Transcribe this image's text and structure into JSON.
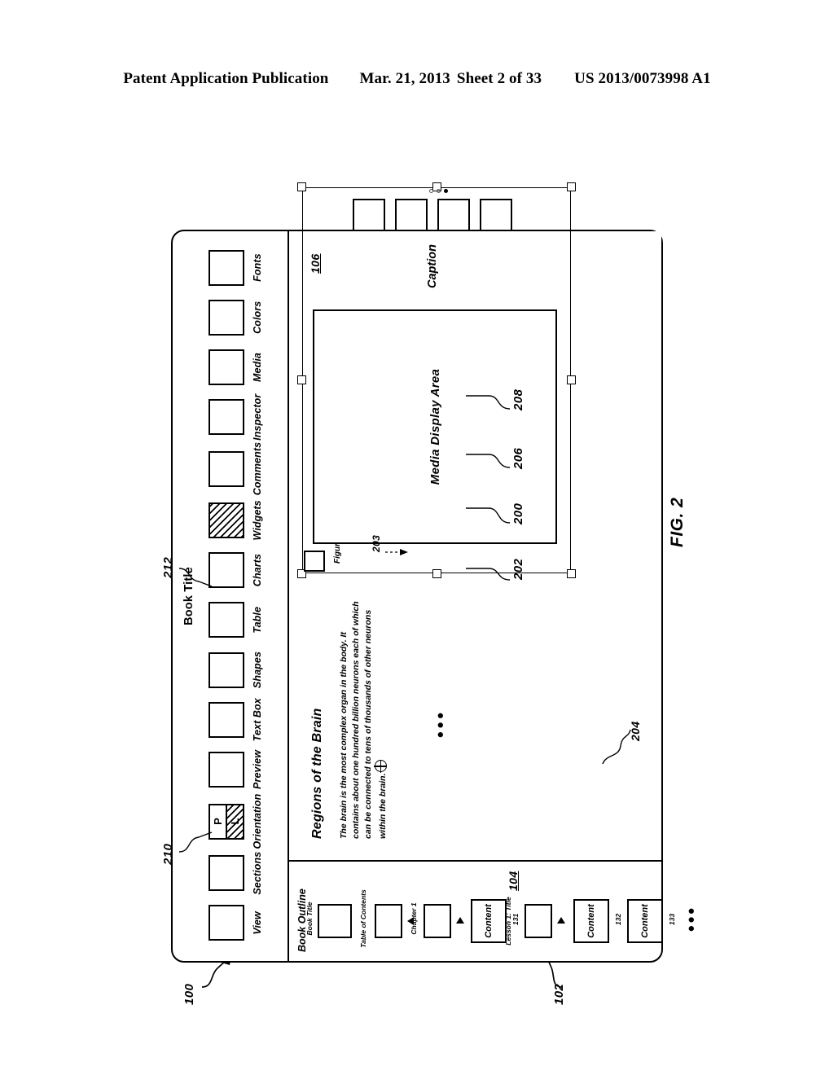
{
  "header": {
    "left": "Patent Application Publication",
    "date": "Mar. 21, 2013",
    "sheet": "Sheet 2 of 33",
    "pubnum": "US 2013/0073998 A1"
  },
  "figure": {
    "caption": "FIG. 2"
  },
  "window": {
    "title": "Book Title"
  },
  "toolbar": {
    "items": [
      {
        "label": "View",
        "type": "button",
        "selected": false
      },
      {
        "label": "Sections",
        "type": "button",
        "selected": false
      },
      {
        "label": "Orientation",
        "type": "split",
        "top": "P",
        "bottom": "L",
        "selected": "L"
      },
      {
        "label": "Preview",
        "type": "button",
        "selected": false
      },
      {
        "label": "Text Box",
        "type": "button",
        "selected": false
      },
      {
        "label": "Shapes",
        "type": "button",
        "selected": false
      },
      {
        "label": "Table",
        "type": "button",
        "selected": false
      },
      {
        "label": "Charts",
        "type": "button",
        "selected": false
      },
      {
        "label": "Widgets",
        "type": "button",
        "selected": true
      },
      {
        "label": "Comments",
        "type": "button",
        "selected": false
      },
      {
        "label": "Inspector",
        "type": "button",
        "selected": false
      },
      {
        "label": "Media",
        "type": "button",
        "selected": false
      },
      {
        "label": "Colors",
        "type": "button",
        "selected": false
      },
      {
        "label": "Fonts",
        "type": "button",
        "selected": false
      }
    ]
  },
  "outline": {
    "title": "Book Outline",
    "nodes": [
      {
        "caption": "Book Title",
        "boxlabel": "",
        "ref": "",
        "marker": "",
        "selected": false
      },
      {
        "caption": "Table of Contents",
        "boxlabel": "",
        "ref": "",
        "marker": "up",
        "selected": false
      },
      {
        "caption": "Chapter 1",
        "boxlabel": "",
        "ref": "",
        "marker": "right",
        "selected": false
      },
      {
        "caption": "",
        "boxlabel": "Content",
        "ref": "131",
        "marker": "",
        "selected": false
      },
      {
        "caption": "Lesson 1: Title",
        "boxlabel": "",
        "ref": "",
        "marker": "right",
        "selected": false
      },
      {
        "caption": "",
        "boxlabel": "Content",
        "ref": "132",
        "marker": "",
        "selected": true
      },
      {
        "caption": "",
        "boxlabel": "Content",
        "ref": "133",
        "marker": "",
        "selected": false
      }
    ],
    "ellipsis": "•••"
  },
  "document": {
    "heading": "Regions of the Brain",
    "body": "The brain is the most complex organ in the body.  It contains about one hundred billion neurons each of which can be connected to tens of thousands of other neurons within the brain.",
    "ellipsis": "•••"
  },
  "widget": {
    "figure_label": "Figure n: label",
    "media_area": "Media Display Area",
    "caption": "Caption",
    "thumbnail_count": 4,
    "page_dots": 3,
    "active_dot": 3
  },
  "refs": {
    "r100": "100",
    "r102": "102",
    "r104": "104",
    "r106": "106",
    "r200": "200",
    "r202": "202",
    "r203": "203",
    "r204": "204",
    "r206": "206",
    "r208": "208",
    "r210": "210",
    "r212": "212"
  }
}
